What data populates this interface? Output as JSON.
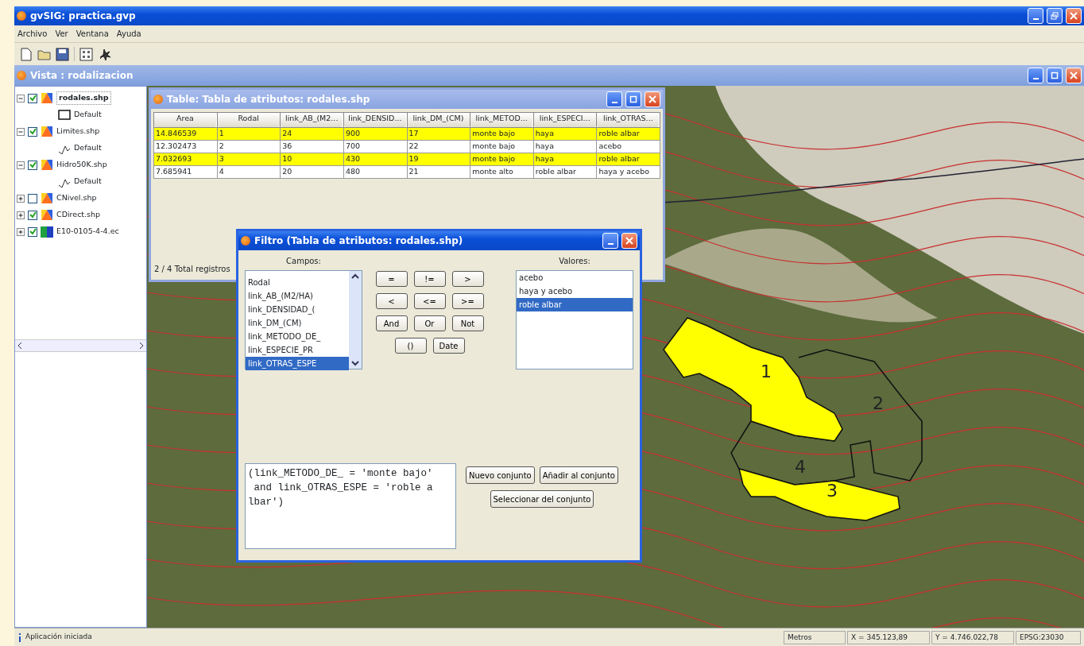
{
  "window": {
    "title": "gvSIG: practica.gvp"
  },
  "menu": [
    "Archivo",
    "Ver",
    "Ventana",
    "Ayuda"
  ],
  "view": {
    "title": "Vista : rodalizacion",
    "layers": [
      {
        "name": "rodales.shp",
        "kind": "vector",
        "visible": true,
        "expanded": true,
        "selected": true,
        "legend": [
          {
            "label": "Default",
            "kind": "polygon"
          }
        ]
      },
      {
        "name": "Limites.shp",
        "kind": "vector",
        "visible": true,
        "expanded": true,
        "selected": false,
        "legend": [
          {
            "label": "Default",
            "kind": "line"
          }
        ]
      },
      {
        "name": "Hidro50K.shp",
        "kind": "vector",
        "visible": true,
        "expanded": true,
        "selected": false,
        "legend": [
          {
            "label": "Default",
            "kind": "line"
          }
        ]
      },
      {
        "name": "CNivel.shp",
        "kind": "vector",
        "visible": false,
        "expanded": false,
        "selected": false
      },
      {
        "name": "CDirect.shp",
        "kind": "vector",
        "visible": true,
        "expanded": false,
        "selected": false
      },
      {
        "name": "E10-0105-4-4.ec",
        "kind": "raster",
        "visible": true,
        "expanded": false,
        "selected": false
      }
    ],
    "map_labels": [
      "1",
      "2",
      "3",
      "4"
    ]
  },
  "table": {
    "title": "Table: Tabla de atributos: rodales.shp",
    "columns": [
      "Area",
      "Rodal",
      "link_AB_(M2...",
      "link_DENSID...",
      "link_DM_(CM)",
      "link_METOD...",
      "link_ESPECI...",
      "link_OTRAS..."
    ],
    "rows": [
      {
        "selected": true,
        "cells": [
          "14.846539",
          "1",
          "24",
          "900",
          "17",
          "monte bajo",
          "haya",
          "roble albar"
        ]
      },
      {
        "selected": false,
        "cells": [
          "12.302473",
          "2",
          "36",
          "700",
          "22",
          "monte bajo",
          "haya",
          "acebo"
        ]
      },
      {
        "selected": true,
        "cells": [
          "7.032693",
          "3",
          "10",
          "430",
          "19",
          "monte bajo",
          "haya",
          "roble albar"
        ]
      },
      {
        "selected": false,
        "cells": [
          "7.685941",
          "4",
          "20",
          "480",
          "21",
          "monte alto",
          "roble albar",
          "haya y acebo"
        ]
      }
    ],
    "footer": "2 / 4 Total registros"
  },
  "filter": {
    "title": "Filtro (Tabla de atributos: rodales.shp)",
    "fields_label": "Campos:",
    "fields": [
      {
        "label": "Rodal",
        "selected": false
      },
      {
        "label": "link_AB_(M2/HA)",
        "selected": false
      },
      {
        "label": "link_DENSIDAD_(",
        "selected": false
      },
      {
        "label": "link_DM_(CM)",
        "selected": false
      },
      {
        "label": "link_METODO_DE_",
        "selected": false
      },
      {
        "label": "link_ESPECIE_PR",
        "selected": false
      },
      {
        "label": "link_OTRAS_ESPE",
        "selected": true
      }
    ],
    "operators": [
      [
        "=",
        "!=",
        ">"
      ],
      [
        "<",
        "<=",
        ">="
      ],
      [
        "And",
        "Or",
        "Not"
      ],
      [
        "()",
        "Date"
      ]
    ],
    "values_label": "Valores:",
    "values": [
      {
        "label": "acebo",
        "selected": false
      },
      {
        "label": "haya y acebo",
        "selected": false
      },
      {
        "label": "roble albar",
        "selected": true
      }
    ],
    "expression": "(link_METODO_DE_ = 'monte bajo'\n and link_OTRAS_ESPE = 'roble a\nlbar')",
    "buttons": [
      "Nuevo conjunto",
      "Añadir al conjunto",
      "Seleccionar del conjunto"
    ]
  },
  "status_bar": {
    "message": "Aplicación iniciada",
    "units": "Metros",
    "x": "X = 345.123,89",
    "y": "Y = 4.746.022,78",
    "crs": "EPSG:23030"
  }
}
